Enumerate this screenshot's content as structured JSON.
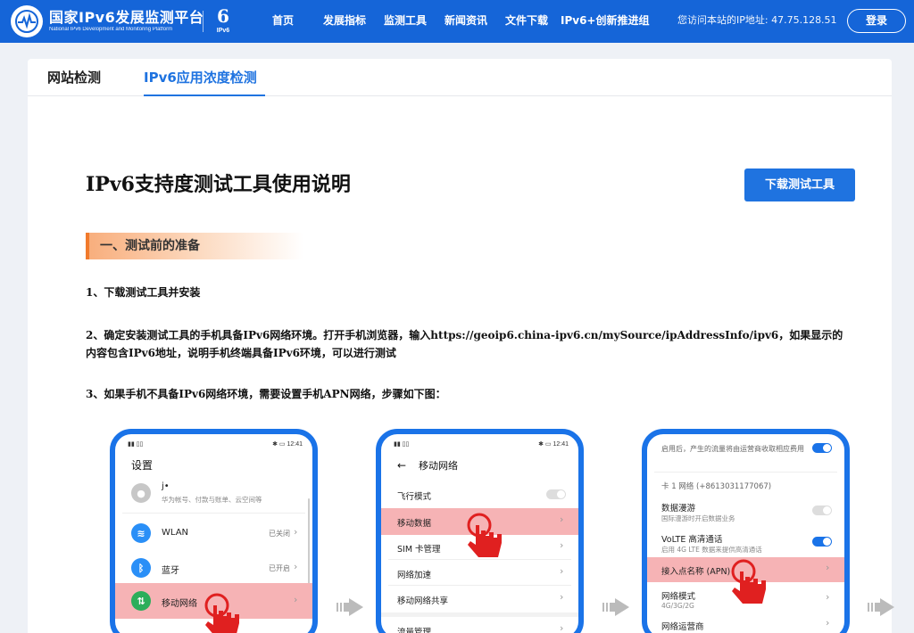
{
  "header": {
    "site_title": "国家IPv6发展监测平台",
    "site_subtitle": "National IPv6 Development and Monitoring Platform",
    "badge_glyph": "6",
    "badge_caption": "IPv6",
    "nav": [
      "首页",
      "发展指标",
      "监测工具",
      "新闻资讯",
      "文件下载",
      "IPv6+创新推进组"
    ],
    "visitor_ip_text": "您访问本站的IP地址: 47.75.128.51",
    "login_label": "登录"
  },
  "tabs": {
    "site_check": "网站检测",
    "ipv6_usage_check": "IPv6应用浓度检测",
    "active": "IPv6应用浓度检测"
  },
  "content": {
    "title": "IPv6支持度测试工具使用说明",
    "download_button": "下载测试工具",
    "section1_title": "一、测试前的准备",
    "step1": "1、下载测试工具并安装",
    "step2": "2、确定安装测试工具的手机具备IPv6网络环境。打开手机浏览器，输入https://geoip6.china-ipv6.cn/mySource/ipAddressInfo/ipv6，如果显示的内容包含IPv6地址，说明手机终端具备IPv6环境，可以进行测试",
    "step3": "3、如果手机不具备IPv6网络环境，需要设置手机APN网络，步骤如下图："
  },
  "phones": {
    "status_time": "12:41",
    "p1": {
      "title": "设置",
      "account_name": "j•",
      "account_sub": "华为帐号、付款与账单、云空间等",
      "wlan": "WLAN",
      "wlan_state": "已关闭",
      "bluetooth": "蓝牙",
      "bluetooth_state": "已开启",
      "mobile_network": "移动网络"
    },
    "p2": {
      "title": "移动网络",
      "airplane": "飞行模式",
      "mobile_data": "移动数据",
      "sim": "SIM 卡管理",
      "accel": "网络加速",
      "share": "移动网络共享",
      "traffic": "流量管理"
    },
    "p3": {
      "top_note": "启用后，产生的流量将由运营商收取相应费用",
      "card": "卡 1 网络 (+8613031177067)",
      "roaming": "数据漫游",
      "roaming_sub": "国际漫游时开启数据业务",
      "volte": "VoLTE 高清通话",
      "volte_sub": "启用 4G LTE 数据来提供高清通话",
      "apn": "接入点名称 (APN)",
      "mode": "网络模式",
      "mode_sub": "4G/3G/2G",
      "carrier": "网络运营商"
    }
  },
  "colors": {
    "brand_blue": "#1565d8",
    "accent_blue": "#1f73e0",
    "section_orange": "#f17a2c",
    "highlight_pink": "#f6b3b5",
    "hand_red": "#e02020"
  }
}
